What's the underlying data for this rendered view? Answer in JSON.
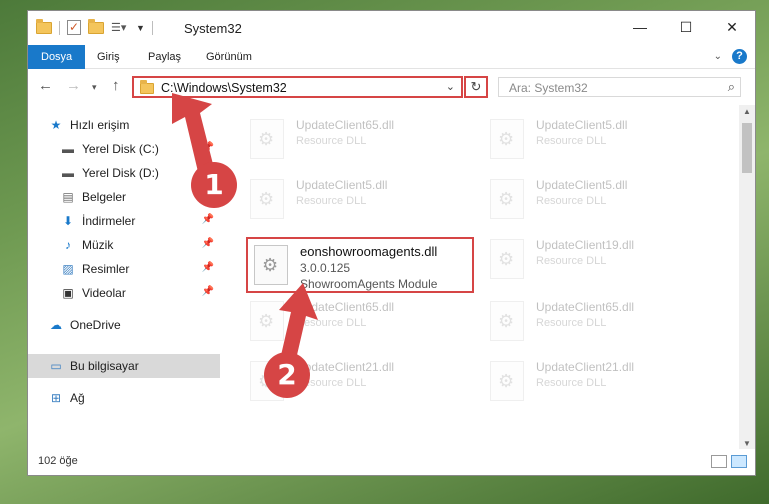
{
  "window": {
    "title": "System32",
    "minimize": "—",
    "maximize": "☐",
    "close": "✕"
  },
  "ribbon": {
    "tabs": [
      "Dosya",
      "Giriş",
      "Paylaş",
      "Görünüm"
    ]
  },
  "address": {
    "path": "C:\\Windows\\System32",
    "search_placeholder": "Ara: System32"
  },
  "sidebar": {
    "items": [
      {
        "label": "Hızlı erişim",
        "icon": "star-icon"
      },
      {
        "label": "Yerel Disk (C:)",
        "icon": "drive-icon",
        "pinned": true
      },
      {
        "label": "Yerel Disk (D:)",
        "icon": "drive-icon",
        "pinned": true
      },
      {
        "label": "Belgeler",
        "icon": "document-icon",
        "pinned": true
      },
      {
        "label": "İndirmeler",
        "icon": "download-icon",
        "pinned": true
      },
      {
        "label": "Müzik",
        "icon": "music-icon",
        "pinned": true
      },
      {
        "label": "Resimler",
        "icon": "pictures-icon",
        "pinned": true
      },
      {
        "label": "Videolar",
        "icon": "video-icon",
        "pinned": true
      },
      {
        "label": "OneDrive",
        "icon": "cloud-icon"
      },
      {
        "label": "Bu bilgisayar",
        "icon": "computer-icon"
      },
      {
        "label": "Ağ",
        "icon": "network-icon"
      }
    ]
  },
  "files": [
    {
      "name": "UpdateClient65.dll",
      "sub": "Resource DLL"
    },
    {
      "name": "UpdateClient5.dll",
      "sub": "Resource DLL"
    },
    {
      "name": "UpdateClient5.dll",
      "sub": "Resource DLL"
    },
    {
      "name": "UpdateClient5.dll",
      "sub": "Resource DLL"
    },
    {
      "name": "eonshowroomagents.dll",
      "sub": "3.0.0.125",
      "sub2": "ShowroomAgents Module"
    },
    {
      "name": "UpdateClient19.dll",
      "sub": "Resource DLL"
    },
    {
      "name": "UpdateClient65.dll",
      "sub": "Resource DLL"
    },
    {
      "name": "UpdateClient65.dll",
      "sub": "Resource DLL"
    },
    {
      "name": "UpdateClient21.dll",
      "sub": "Resource DLL"
    },
    {
      "name": "UpdateClient21.dll",
      "sub": "Resource DLL"
    }
  ],
  "status": {
    "count": "102 öğe"
  },
  "callouts": [
    "1",
    "2"
  ],
  "colors": {
    "accent": "#1979ca",
    "highlight": "#d64545",
    "selection": "#d9d9d9"
  }
}
